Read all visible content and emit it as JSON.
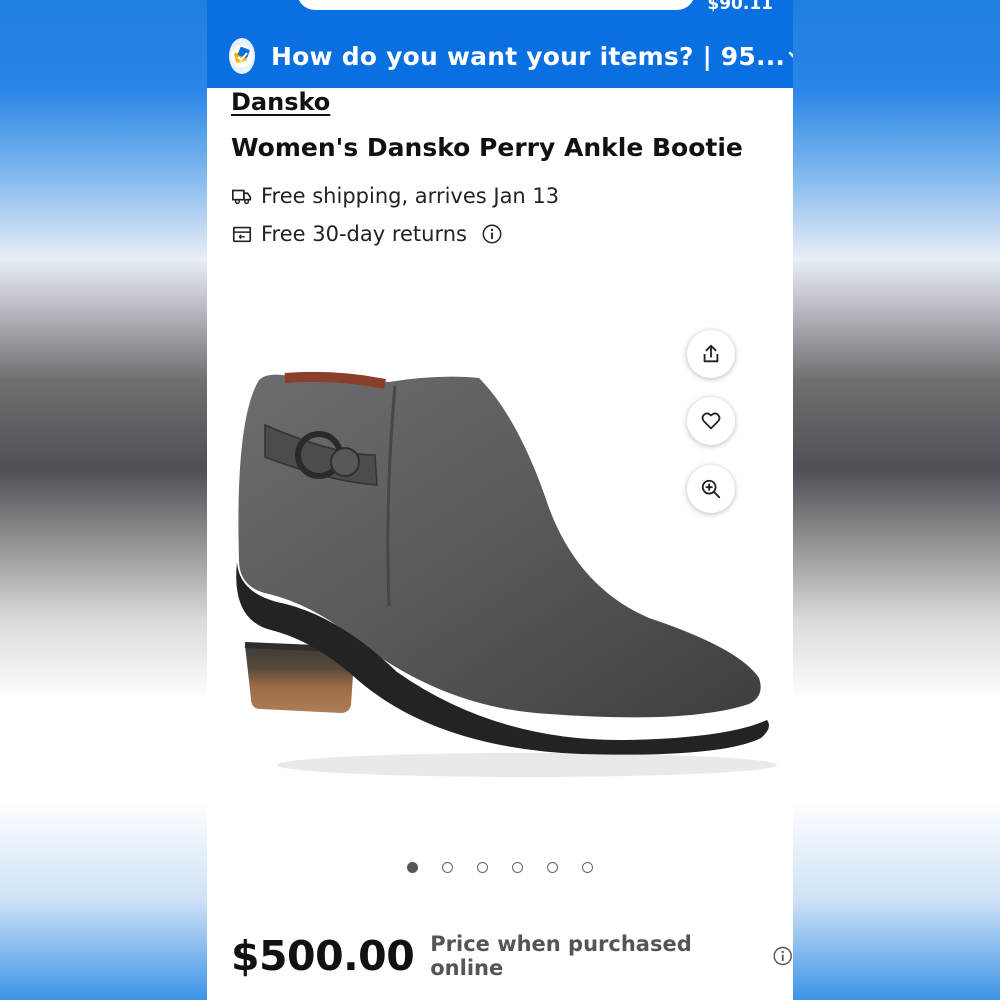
{
  "header": {
    "cart_total": "$90.11",
    "delivery_prompt": "How do you want your items? | 95...",
    "accent_color": "#0a6fe0"
  },
  "product": {
    "brand": "Dansko",
    "title": "Women's Dansko Perry Ankle Bootie",
    "shipping": "Free shipping, arrives Jan 13",
    "returns": "Free 30-day returns",
    "image_count": 6,
    "active_image_index": 0
  },
  "pricing": {
    "price": "$500.00",
    "note": "Price when purchased online"
  },
  "icons": {
    "share": "share-icon",
    "favorite": "heart-icon",
    "zoom": "zoom-in-icon",
    "truck": "truck-icon",
    "returns": "returns-box-icon",
    "info": "info-icon",
    "delivery": "delivery-option-icon",
    "expand": "chevron-down-icon"
  }
}
